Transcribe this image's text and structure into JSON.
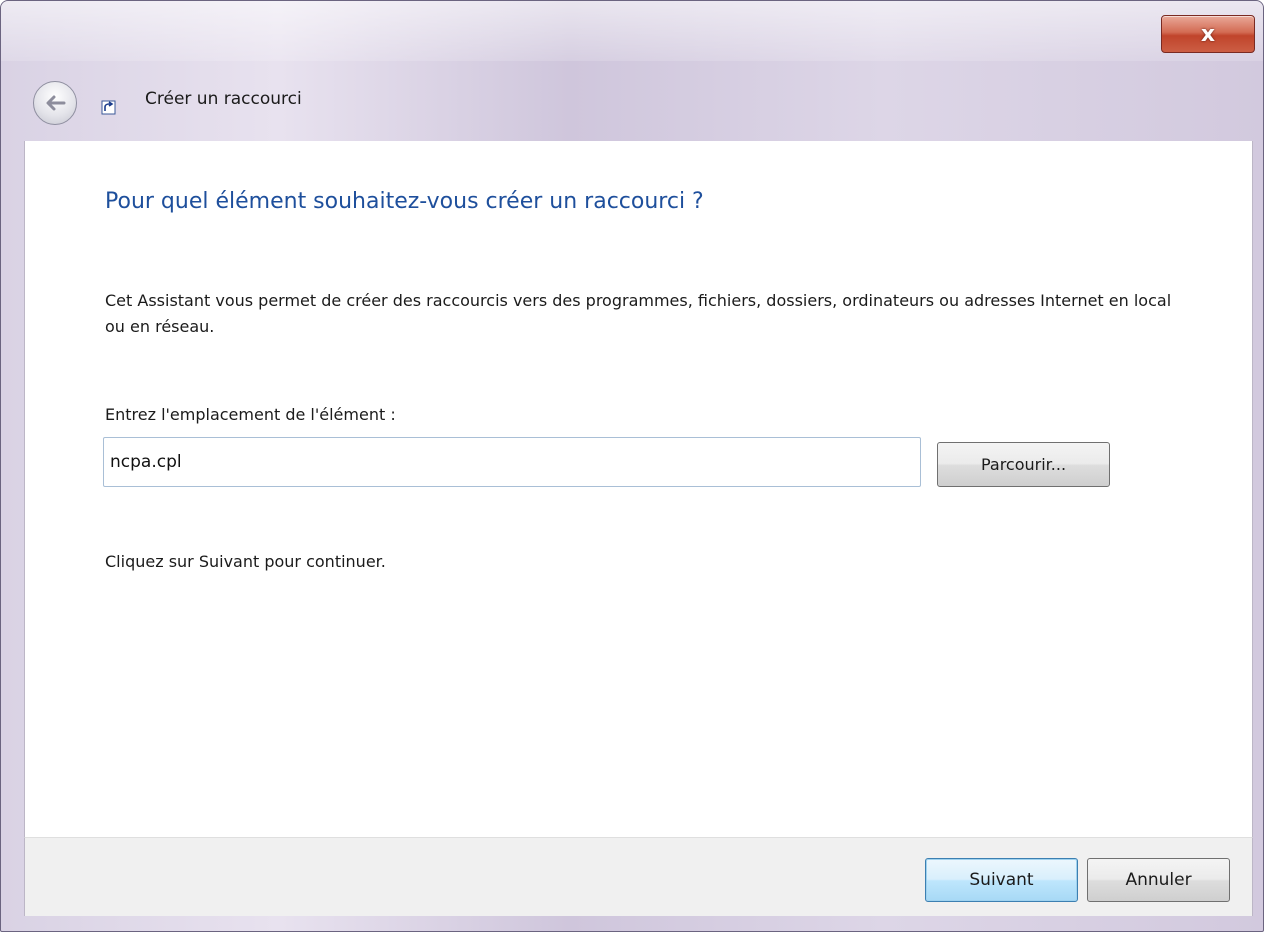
{
  "window": {
    "title": "Créer un raccourci",
    "close_glyph": "x"
  },
  "icons": {
    "back": "back-arrow-icon",
    "shortcut": "shortcut-icon",
    "close": "close-icon"
  },
  "wizard": {
    "heading": "Pour quel élément souhaitez-vous créer un raccourci ?",
    "intro": "Cet Assistant vous permet de créer des raccourcis vers des programmes, fichiers, dossiers, ordinateurs ou adresses Internet en local ou en réseau.",
    "location_label": "Entrez l'emplacement de l'élément :",
    "location_value": "ncpa.cpl",
    "browse_label": "Parcourir...",
    "continue_text": "Cliquez sur Suivant pour continuer."
  },
  "footer": {
    "next_label": "Suivant",
    "cancel_label": "Annuler"
  },
  "colors": {
    "heading": "#1e4f9c",
    "close_button": "#c0442b",
    "default_button_border": "#3c7fb1"
  }
}
